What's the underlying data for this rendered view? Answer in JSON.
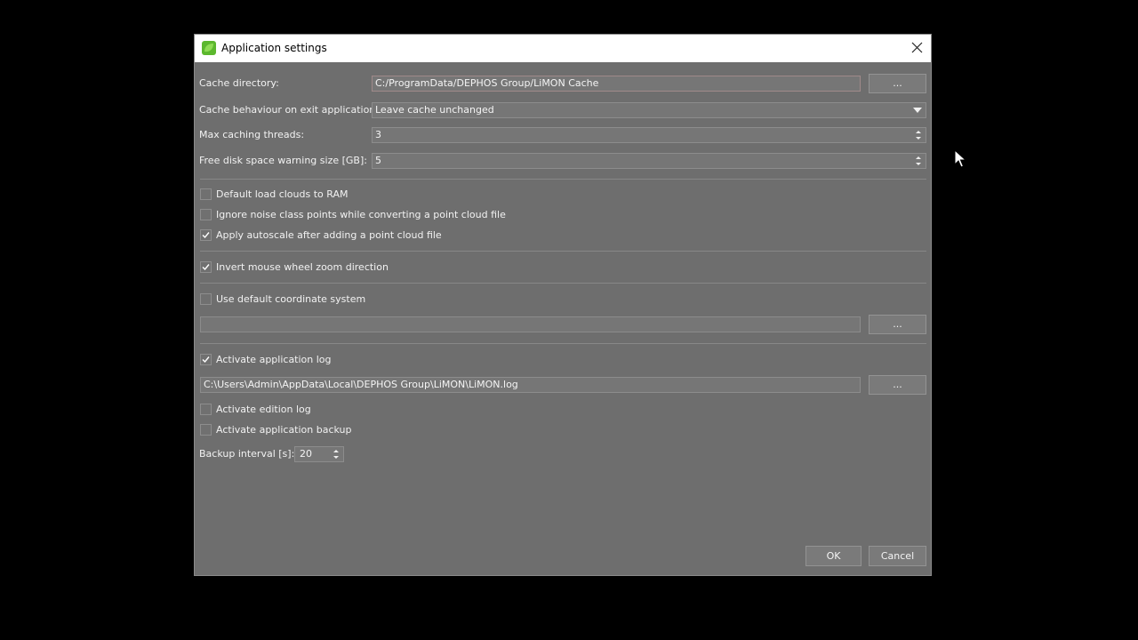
{
  "dialog": {
    "title": "Application settings",
    "close_icon": "close-icon",
    "app_icon": "limon-app-icon"
  },
  "cache": {
    "directory_label": "Cache directory:",
    "directory_value": "C:/ProgramData/DEPHOS Group/LiMON Cache",
    "browse_label": "...",
    "behaviour_label": "Cache behaviour on exit application:",
    "behaviour_value": "Leave cache unchanged",
    "threads_label": "Max caching threads:",
    "threads_value": "3",
    "disk_warning_label": "Free disk space warning size [GB]:",
    "disk_warning_value": "5"
  },
  "options": {
    "default_load_ram": {
      "label": "Default load clouds to RAM",
      "checked": false
    },
    "ignore_noise": {
      "label": "Ignore noise class points while converting a point cloud file",
      "checked": false
    },
    "autoscale": {
      "label": "Apply autoscale after adding a point cloud file",
      "checked": true
    },
    "invert_wheel": {
      "label": "Invert mouse wheel zoom direction",
      "checked": true
    },
    "default_coord": {
      "label": "Use default coordinate system",
      "checked": false
    }
  },
  "coordinate": {
    "value": "",
    "browse_label": "..."
  },
  "logging": {
    "app_log": {
      "label": "Activate application log",
      "checked": true
    },
    "log_path": "C:\\Users\\Admin\\AppData\\Local\\DEPHOS Group\\LiMON\\LiMON.log",
    "browse_label": "...",
    "edition_log": {
      "label": "Activate edition log",
      "checked": false
    },
    "app_backup": {
      "label": "Activate application backup",
      "checked": false
    },
    "backup_interval_label": "Backup interval [s]:",
    "backup_interval_value": "20"
  },
  "footer": {
    "ok_label": "OK",
    "cancel_label": "Cancel"
  },
  "colors": {
    "dialog_bg": "#6e6e6e",
    "titlebar_bg": "#ffffff",
    "app_icon_green": "#5cb82e"
  }
}
